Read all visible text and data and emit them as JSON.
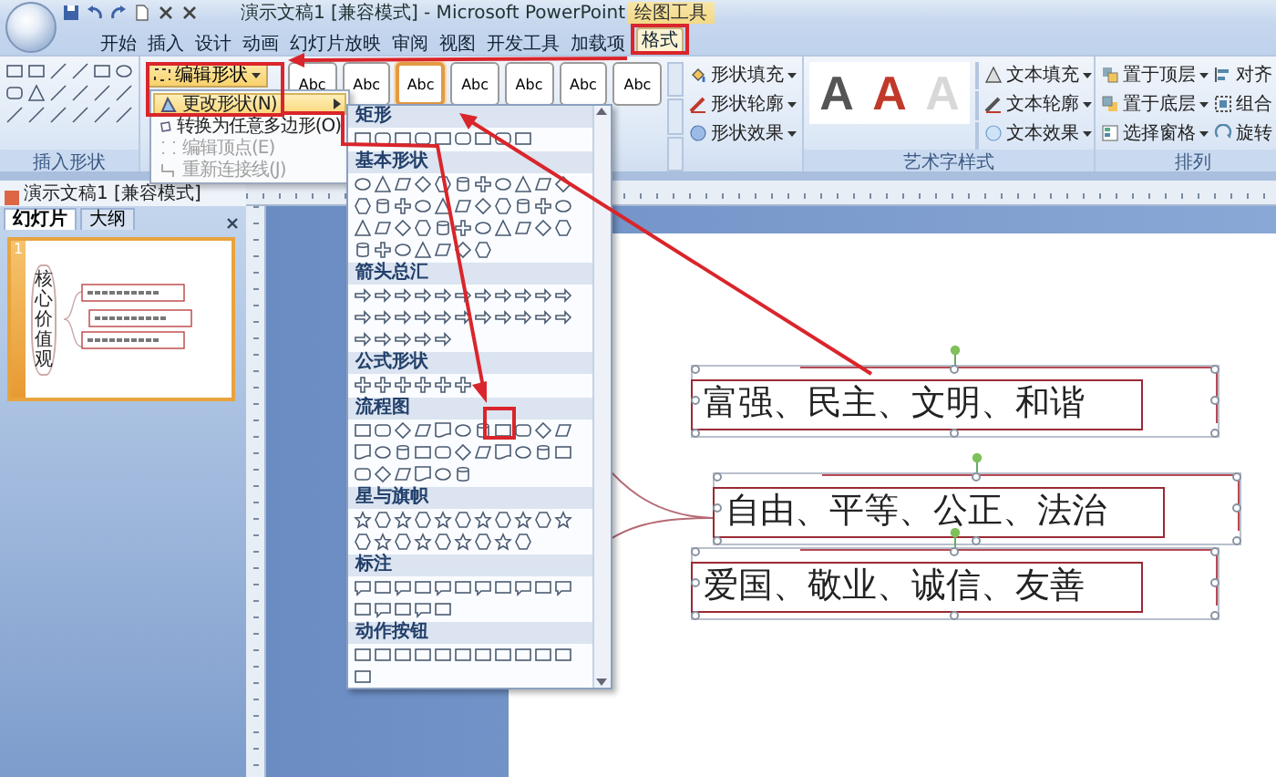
{
  "window": {
    "title": "演示文稿1 [兼容模式] - Microsoft PowerPoint",
    "context_tab_group": "绘图工具"
  },
  "tabs": [
    {
      "label": "开始",
      "selected": false
    },
    {
      "label": "插入",
      "selected": false
    },
    {
      "label": "设计",
      "selected": false
    },
    {
      "label": "动画",
      "selected": false
    },
    {
      "label": "幻灯片放映",
      "selected": false
    },
    {
      "label": "审阅",
      "selected": false
    },
    {
      "label": "视图",
      "selected": false
    },
    {
      "label": "开发工具",
      "selected": false
    },
    {
      "label": "加载项",
      "selected": false
    },
    {
      "label": "格式",
      "selected": true
    }
  ],
  "ribbon": {
    "insert_shapes": {
      "edit_shape_button": "编辑形状",
      "group_label": "插入形状"
    },
    "shape_styles": {
      "thumbnails": [
        {
          "label": "Abc",
          "selected": false
        },
        {
          "label": "Abc",
          "selected": false
        },
        {
          "label": "Abc",
          "selected": true
        },
        {
          "label": "Abc",
          "selected": false
        },
        {
          "label": "Abc",
          "selected": false
        },
        {
          "label": "Abc",
          "selected": false
        },
        {
          "label": "Abc",
          "selected": false
        }
      ],
      "commands": [
        "形状填充",
        "形状轮廓",
        "形状效果"
      ]
    },
    "wordart_styles": {
      "samples": [
        {
          "label": "A",
          "color": "#555555"
        },
        {
          "label": "A",
          "color": "#c0392b"
        },
        {
          "label": "A",
          "color": "#d8d8d8"
        }
      ],
      "commands": [
        "文本填充",
        "文本轮廓",
        "文本效果"
      ],
      "group_label": "艺术字样式"
    },
    "arrange": {
      "commands": [
        "置于顶层",
        "置于底层",
        "选择窗格",
        "对齐",
        "组合",
        "旋转"
      ],
      "group_label": "排列"
    }
  },
  "edit_shape_menu": {
    "items": [
      {
        "label": "更改形状(N)",
        "kind": "submenu",
        "selected": true,
        "disabled": false
      },
      {
        "label": "转换为任意多边形(O)",
        "kind": "command",
        "selected": false,
        "disabled": false
      },
      {
        "label": "编辑顶点(E)",
        "kind": "command",
        "selected": false,
        "disabled": true
      },
      {
        "label": "重新连接线(J)",
        "kind": "command",
        "selected": false,
        "disabled": true
      }
    ]
  },
  "shape_gallery": {
    "sections": [
      {
        "title": "矩形"
      },
      {
        "title": "基本形状"
      },
      {
        "title": "箭头总汇"
      },
      {
        "title": "公式形状"
      },
      {
        "title": "流程图"
      },
      {
        "title": "星与旗帜"
      },
      {
        "title": "标注"
      },
      {
        "title": "动作按钮"
      }
    ]
  },
  "left_panel": {
    "document_tab": "演示文稿1 [兼容模式]",
    "tabs": [
      {
        "label": "幻灯片",
        "selected": true
      },
      {
        "label": "大纲",
        "selected": false
      }
    ],
    "thumbnail": {
      "number": "1",
      "title": "核心价值观",
      "selected": true
    }
  },
  "slide": {
    "items": [
      {
        "text": "富强、民主、文明、和谐",
        "selected": true
      },
      {
        "text": "自由、平等、公正、法治",
        "selected": true
      },
      {
        "text": "爱国、敬业、诚信、友善",
        "selected": true
      }
    ]
  }
}
